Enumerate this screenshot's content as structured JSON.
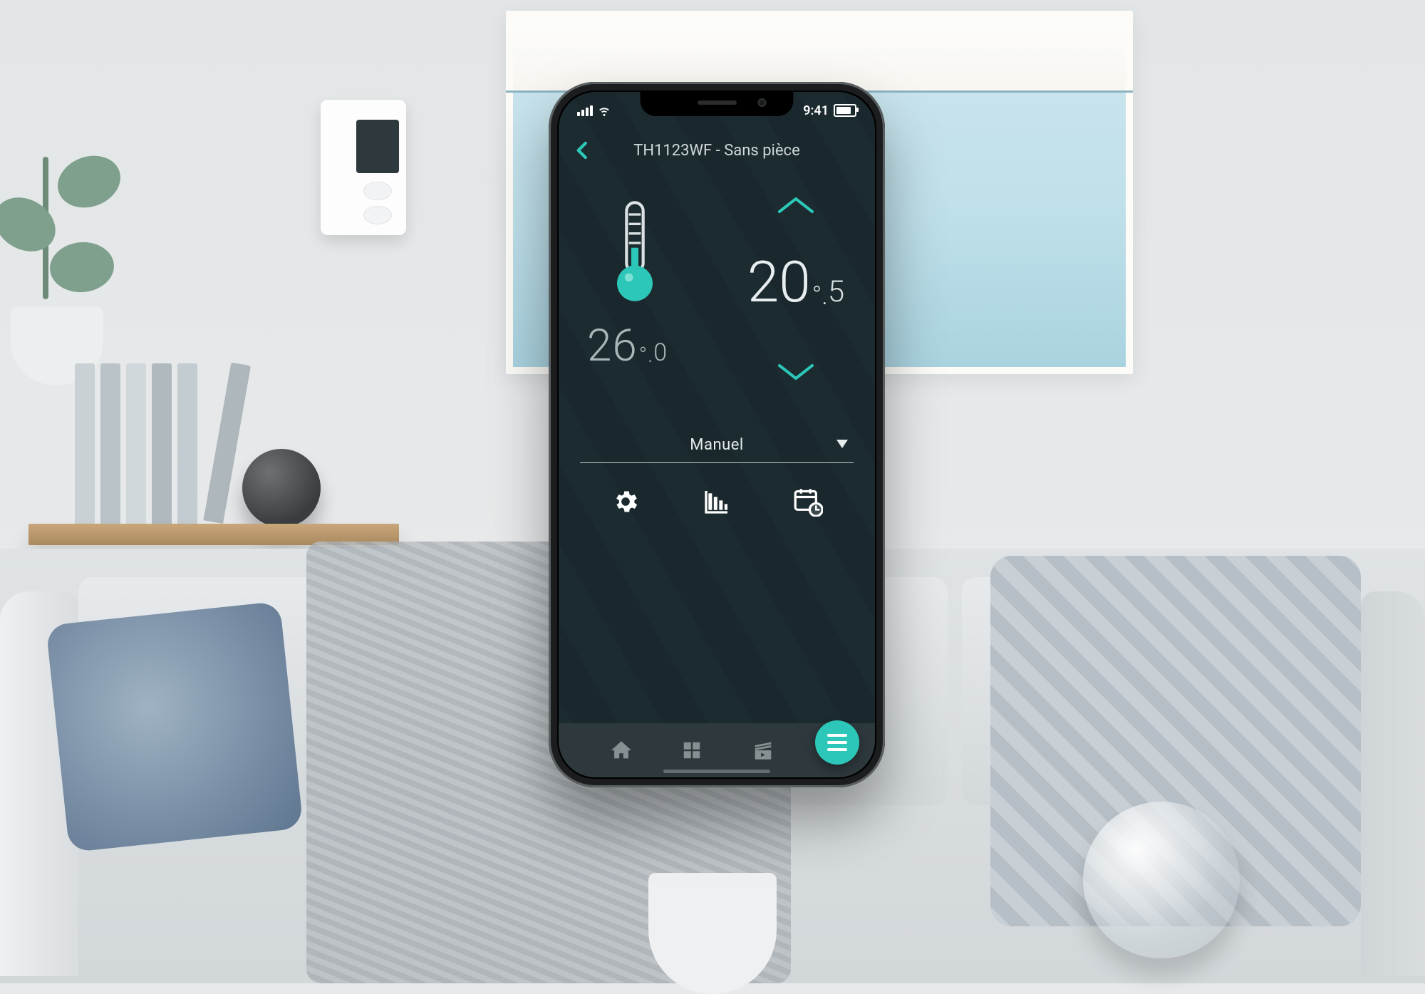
{
  "status_bar": {
    "time": "9:41"
  },
  "header": {
    "title": "TH1123WF - Sans pièce"
  },
  "current_temp": {
    "whole": "26",
    "decimal": "0"
  },
  "set_temp": {
    "whole": "20",
    "decimal": "5"
  },
  "mode": {
    "label": "Manuel"
  },
  "colors": {
    "accent": "#2cc7b8"
  }
}
